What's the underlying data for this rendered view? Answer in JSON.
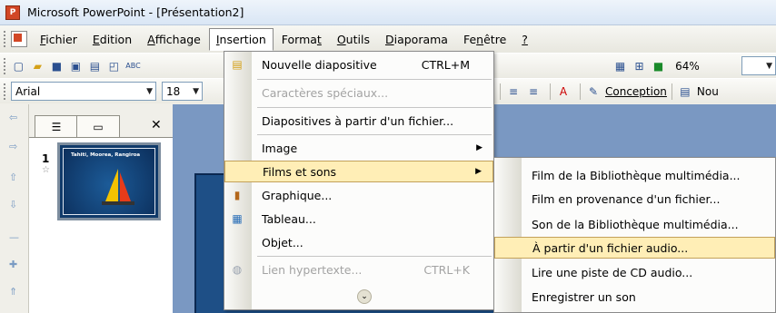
{
  "window": {
    "title": "Microsoft PowerPoint - [Présentation2]",
    "app_icon": "powerpoint-icon"
  },
  "menubar": {
    "items": [
      {
        "label": "Fichier",
        "accel": "F"
      },
      {
        "label": "Edition",
        "accel": "E"
      },
      {
        "label": "Affichage",
        "accel": "A"
      },
      {
        "label": "Insertion",
        "accel": "I",
        "open": true
      },
      {
        "label": "Format",
        "accel": "t"
      },
      {
        "label": "Outils",
        "accel": "O"
      },
      {
        "label": "Diaporama",
        "accel": "D"
      },
      {
        "label": "Fenêtre",
        "accel": "n"
      },
      {
        "label": "?",
        "accel": "?"
      }
    ]
  },
  "toolbar_standard": {
    "zoom": "64%"
  },
  "toolbar_format": {
    "font": "Arial",
    "size": "18",
    "conception_label": "Conception",
    "nouvelle_label": "Nou"
  },
  "slides_panel": {
    "slide_number": "1",
    "thumb_title": "Tahiti, Moorea, Rangiroa"
  },
  "insertion_menu": {
    "items": [
      {
        "label": "Nouvelle diapositive",
        "shortcut": "CTRL+M",
        "icon": "new-slide-icon"
      },
      {
        "label": "Caractères spéciaux...",
        "disabled": true
      },
      {
        "label": "Diapositives à partir d'un fichier..."
      },
      {
        "label": "Image",
        "submenu": true
      },
      {
        "label": "Films et sons",
        "submenu": true,
        "highlighted": true
      },
      {
        "label": "Graphique...",
        "icon": "chart-icon"
      },
      {
        "label": "Tableau...",
        "icon": "table-icon"
      },
      {
        "label": "Objet..."
      },
      {
        "label": "Lien hypertexte...",
        "shortcut": "CTRL+K",
        "disabled": true,
        "icon": "hyperlink-icon"
      }
    ]
  },
  "films_submenu": {
    "items": [
      {
        "label": "Film de la Bibliothèque multimédia..."
      },
      {
        "label": "Film en provenance d'un fichier..."
      },
      {
        "label": "Son de la Bibliothèque multimédia..."
      },
      {
        "label": "À partir d'un fichier audio...",
        "highlighted": true
      },
      {
        "label": "Lire une piste de CD audio..."
      },
      {
        "label": "Enregistrer un son"
      }
    ]
  },
  "colors": {
    "highlight": "#ffeeb6",
    "highlight_border": "#c2a15a",
    "slide_bg": "#1e4f86"
  }
}
